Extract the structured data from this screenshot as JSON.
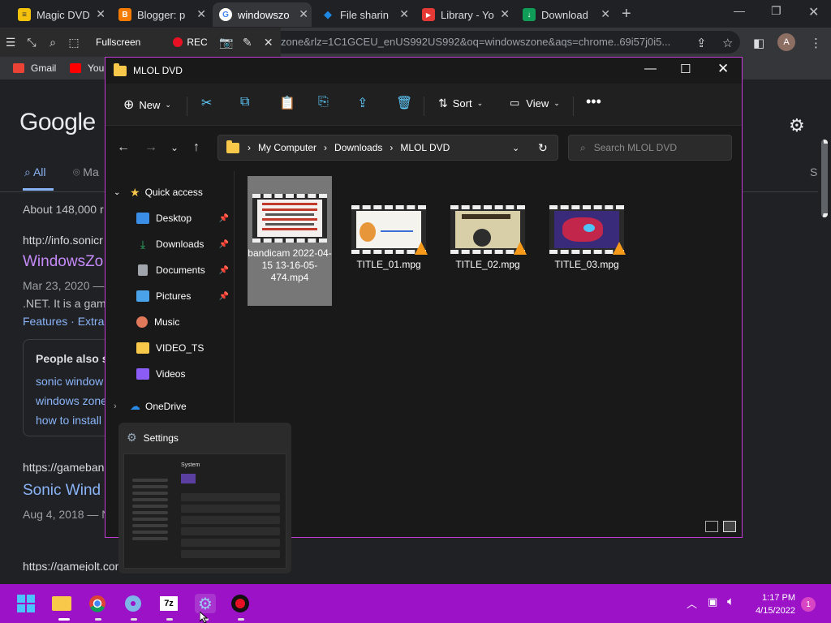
{
  "browser": {
    "tabs": [
      {
        "title": "Magic DVD",
        "fav_color": "#f4c20d",
        "fav_text": "≡"
      },
      {
        "title": "Blogger: p",
        "fav_color": "#f57c00",
        "fav_text": "B"
      },
      {
        "title": "windowszo",
        "fav_color": "#ffffff",
        "fav_text": "G"
      },
      {
        "title": "File sharin",
        "fav_color": "#1e88e5",
        "fav_text": "◆"
      },
      {
        "title": "Library - Yo",
        "fav_color": "#e53935",
        "fav_text": "▶"
      },
      {
        "title": "Download",
        "fav_color": "#0f9d58",
        "fav_text": "↓"
      }
    ],
    "url_visible": "zone&rlz=1C1GCEU_enUS992US992&oq=windowszone&aqs=chrome..69i57j0i5...",
    "avatar_letter": "A",
    "bookmarks": [
      {
        "label": "Gmail",
        "color": "#ea4335"
      },
      {
        "label": "You",
        "color": "#ff0000"
      }
    ]
  },
  "recorder": {
    "fullscreen_label": "Fullscreen",
    "rec_label": "REC"
  },
  "google": {
    "logo": "Google",
    "tabs": {
      "all": "All",
      "maps": "Ma"
    },
    "right_letter": "S",
    "result_count": "About 148,000 r",
    "result1": {
      "url": "http://info.sonicr",
      "title": "WindowsZo",
      "date_snip": "Mar 23, 2020 —",
      "desc": ".NET. It is a gam",
      "sublinks": "Features · Extra"
    },
    "people_also": {
      "heading": "People also s",
      "items": [
        "sonic window",
        "windows zone",
        "how to install"
      ]
    },
    "result2": {
      "url": "https://gameban",
      "title": "Sonic Wind",
      "date_snip": "Aug 4, 2018 — N"
    },
    "result3_url": "https://gamejolt.com"
  },
  "explorer": {
    "title": "MLOL DVD",
    "commands": {
      "new": "New",
      "sort": "Sort",
      "view": "View"
    },
    "breadcrumb": [
      "My Computer",
      "Downloads",
      "MLOL DVD"
    ],
    "search_placeholder": "Search MLOL DVD",
    "nav": {
      "quick_access": "Quick access",
      "items": [
        {
          "label": "Desktop",
          "color": "#3a8ee6",
          "pinned": true
        },
        {
          "label": "Downloads",
          "color": "#2fb36d",
          "pinned": true
        },
        {
          "label": "Documents",
          "color": "#a0a4ab",
          "pinned": true
        },
        {
          "label": "Pictures",
          "color": "#4aa3e8",
          "pinned": true
        },
        {
          "label": "Music",
          "color": "#e0785a",
          "pinned": false
        },
        {
          "label": "VIDEO_TS",
          "color": "#f8c84b",
          "pinned": false
        },
        {
          "label": "Videos",
          "color": "#8b5cf6",
          "pinned": false
        }
      ],
      "onedrive": "OneDrive"
    },
    "files": [
      {
        "name": "bandicam 2022-04-15 13-16-05-474.mp4",
        "selected": true
      },
      {
        "name": "TITLE_01.mpg",
        "selected": false
      },
      {
        "name": "TITLE_02.mpg",
        "selected": false
      },
      {
        "name": "TITLE_03.mpg",
        "selected": false
      }
    ]
  },
  "settings_preview": {
    "title": "Settings",
    "page_heading": "System"
  },
  "taskbar": {
    "time": "1:17 PM",
    "date": "4/15/2022",
    "notification_count": "1"
  }
}
